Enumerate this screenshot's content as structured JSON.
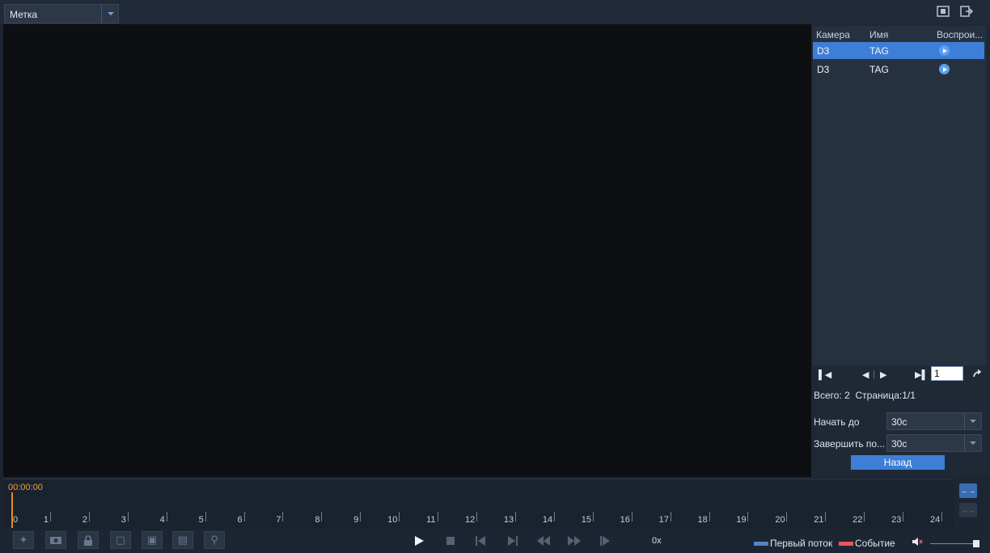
{
  "topbar": {
    "mode_value": "Метка",
    "icons": [
      "fullscreen-icon",
      "exit-icon"
    ]
  },
  "panel": {
    "columns": [
      "Камера",
      "Имя",
      "Воспрои..."
    ],
    "rows": [
      {
        "camera": "D3",
        "name": "TAG",
        "selected": true
      },
      {
        "camera": "D3",
        "name": "TAG",
        "selected": false
      }
    ],
    "page_input": "1",
    "total_label": "Всего: 2",
    "page_label": "Страница:1/1",
    "start_label": "Начать до",
    "start_value": "30с",
    "end_label": "Завершить по...",
    "end_value": "30с",
    "back_label": "Назад"
  },
  "timeline": {
    "time": "00:00:00",
    "hours": [
      "0",
      "1",
      "2",
      "3",
      "4",
      "5",
      "6",
      "7",
      "8",
      "9",
      "10",
      "11",
      "12",
      "13",
      "14",
      "15",
      "16",
      "17",
      "18",
      "19",
      "20",
      "21",
      "22",
      "23",
      "24"
    ]
  },
  "toolbar": {
    "speed": "0x",
    "legend": [
      {
        "label": "Первый поток",
        "color": "#4f86c8"
      },
      {
        "label": "Событие",
        "color": "#e8565f"
      }
    ],
    "volume": 0.95
  },
  "colors": {
    "accent": "#3d7fd6",
    "playhead": "#e58a25"
  }
}
